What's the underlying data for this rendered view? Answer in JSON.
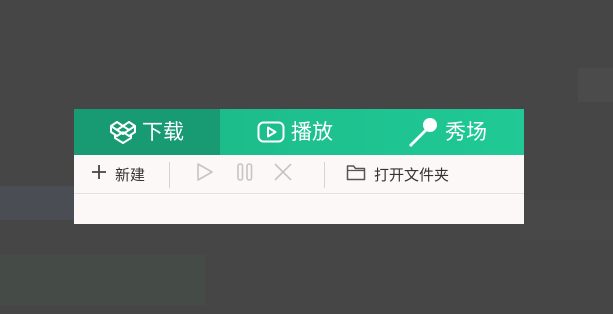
{
  "tabs": {
    "download_label": "下载",
    "play_label": "播放",
    "show_label": "秀场",
    "active": "download"
  },
  "toolbar": {
    "new_label": "新建",
    "open_folder_label": "打开文件夹"
  },
  "colors": {
    "accent": "#1dbf8d",
    "accent_active": "#189b72",
    "toolbar_bg": "#fdf8f8",
    "disabled_icon": "#c8c4c4",
    "text": "#333333"
  },
  "icons": {
    "download_tab": "box-icon",
    "play_tab": "video-play-icon",
    "show_tab": "microphone-icon",
    "new": "plus-icon",
    "start": "play-icon",
    "pause": "pause-icon",
    "cancel": "x-icon",
    "open": "folder-icon"
  }
}
